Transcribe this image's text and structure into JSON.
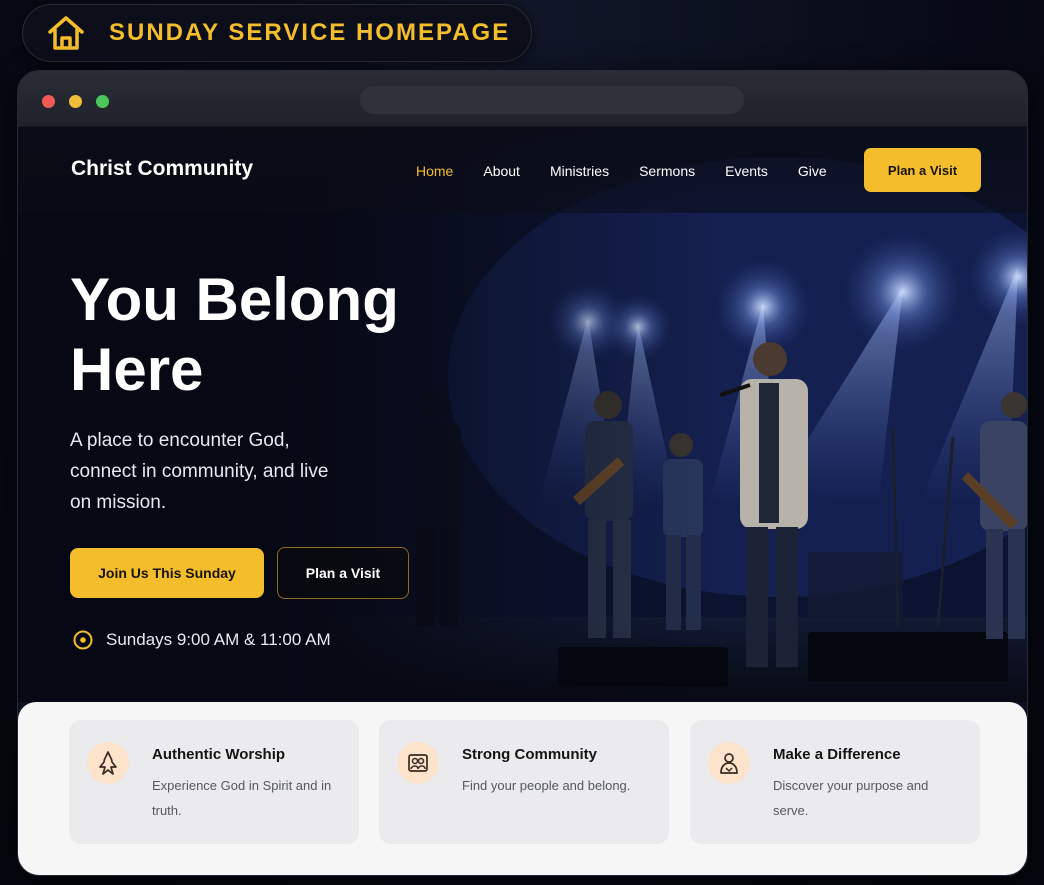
{
  "banner": {
    "title": "SUNDAY SERVICE HOMEPAGE",
    "icon": "home-icon"
  },
  "nav": {
    "brand": "Christ Community",
    "links": [
      {
        "label": "Home",
        "active": true
      },
      {
        "label": "About",
        "active": false
      },
      {
        "label": "Ministries",
        "active": false
      },
      {
        "label": "Sermons",
        "active": false
      },
      {
        "label": "Events",
        "active": false
      },
      {
        "label": "Give",
        "active": false
      }
    ],
    "cta": "Plan a Visit"
  },
  "hero": {
    "title": "You Belong Here",
    "subtitle": "A place to encounter God, connect in community, and live on mission.",
    "primary_button": "Join Us This Sunday",
    "secondary_button": "Plan a Visit",
    "service_times": "Sundays 9:00 AM & 11:00 AM",
    "service_icon": "clock-icon"
  },
  "features": [
    {
      "title": "Authentic Worship",
      "description": "Experience God in Spirit and in truth.",
      "icon": "worship-icon"
    },
    {
      "title": "Strong Community",
      "description": "Find your people and belong.",
      "icon": "community-icon"
    },
    {
      "title": "Make a Difference",
      "description": "Discover your purpose and serve.",
      "icon": "serve-icon"
    }
  ],
  "colors": {
    "accent": "#f3bd2b",
    "background": "#070a16",
    "feature_icon_bg": "#fbe3cc"
  }
}
